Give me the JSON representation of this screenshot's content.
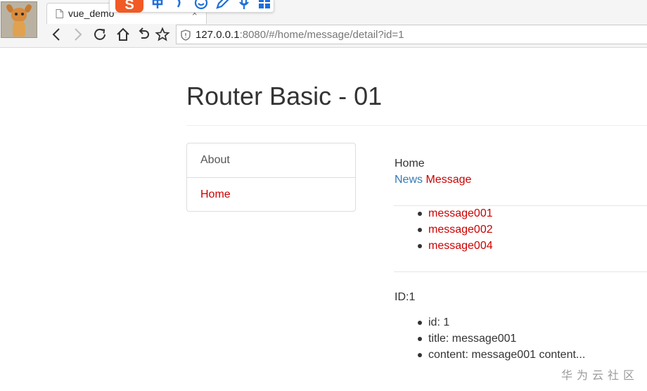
{
  "browser": {
    "tab_title": "vue_demo",
    "tab_close": "×",
    "url_host": "127.0.0.1",
    "url_rest": ":8080/#/home/message/detail?id=1",
    "sogou_glyph": "S",
    "icons": [
      "back-icon",
      "forward-icon",
      "reload-icon",
      "home-icon",
      "undo-icon",
      "star-icon",
      "shield-icon",
      "document-icon"
    ],
    "colors": {
      "sogou": "#f15a24",
      "toolbar_icon": "#1e6fd9"
    }
  },
  "page": {
    "title": "Router Basic - 01",
    "nav": [
      {
        "label": "About",
        "active": false
      },
      {
        "label": "Home",
        "active": true
      }
    ],
    "home_label": "Home",
    "sub_nav": {
      "news": "News",
      "message": "Message"
    },
    "messages": [
      "message001",
      "message002",
      "message004"
    ],
    "detail": {
      "id_label": "ID:1",
      "fields": [
        "id: 1",
        "title: message001",
        "content: message001 content..."
      ]
    },
    "colors": {
      "active_link": "#cc0000",
      "link": "#337ab7"
    }
  },
  "watermark": "华为云社区"
}
